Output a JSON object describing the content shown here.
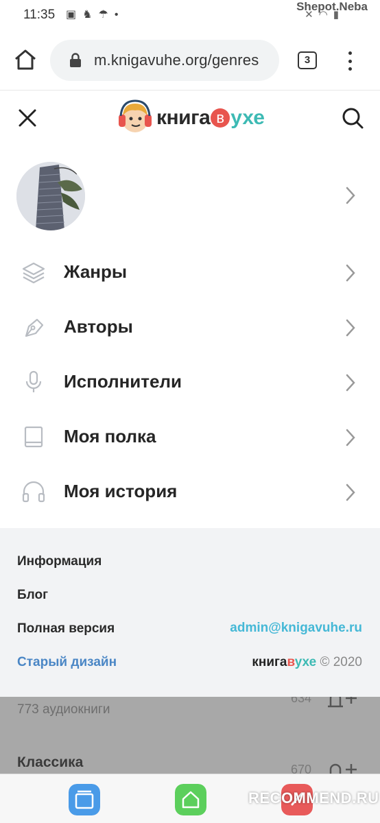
{
  "status_bar": {
    "time": "11:35",
    "right_label": "Shepot.Neba"
  },
  "browser": {
    "url": "m.knigavuhe.org/genres",
    "tab_count": "3"
  },
  "header": {
    "logo_part1": "книга",
    "logo_part2": "в",
    "logo_part3": "ухе"
  },
  "menu": {
    "items": [
      {
        "label": "Жанры",
        "icon": "layers-icon"
      },
      {
        "label": "Авторы",
        "icon": "pen-nib-icon"
      },
      {
        "label": "Исполнители",
        "icon": "microphone-icon"
      },
      {
        "label": "Моя полка",
        "icon": "book-icon"
      },
      {
        "label": "Моя история",
        "icon": "headphones-icon"
      }
    ]
  },
  "footer": {
    "info": "Информация",
    "blog": "Блог",
    "full_version": "Полная версия",
    "old_design": "Старый дизайн",
    "email": "admin@knigavuhe.ru",
    "copy_brand1": "книга",
    "copy_brand2": "в",
    "copy_brand3": "ухе",
    "copy_year": "© 2020"
  },
  "background": {
    "count_text": "773 аудиокниги",
    "num_top": "634",
    "section_title": "Классика",
    "num_bottom": "670"
  },
  "watermark": "RECOMMEND.RU",
  "colors": {
    "accent_teal": "#3dbab4",
    "accent_red": "#e8554e",
    "link_blue": "#4a86c5",
    "email_blue": "#45b8d6"
  }
}
